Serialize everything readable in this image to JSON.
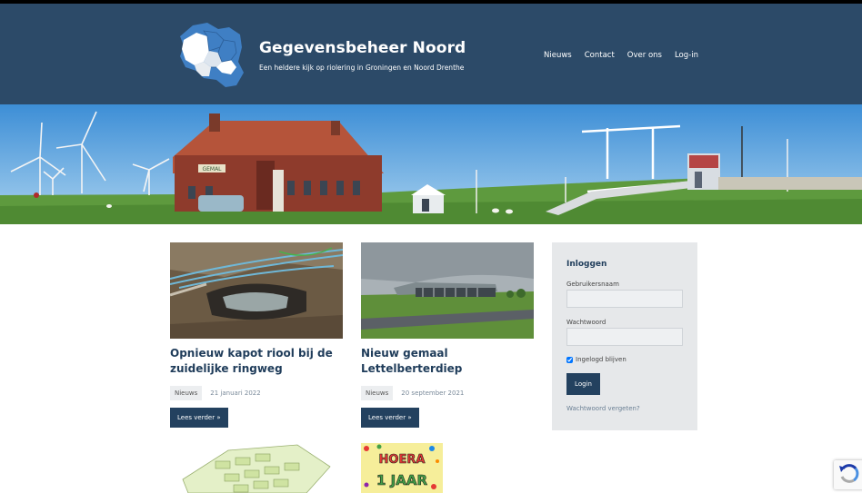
{
  "header": {
    "title": "Gegevensbeheer Noord",
    "tagline": "Een heldere kijk op riolering in Groningen en Noord Drenthe",
    "nav": [
      "Nieuws",
      "Contact",
      "Over ons",
      "Log-in"
    ]
  },
  "hero": {
    "building_sign": "GEMAL"
  },
  "posts": [
    {
      "title": "Opnieuw kapot riool bij de zuidelijke ringweg",
      "category": "Nieuws",
      "date": "21 januari 2022",
      "more": "Lees verder »"
    },
    {
      "title": "Nieuw gemaal Lettelberterdiep",
      "category": "Nieuws",
      "date": "20 september 2021",
      "more": "Lees verder »"
    },
    {
      "image_text_1": "HOERA",
      "image_text_2": "1 JAAR"
    }
  ],
  "login": {
    "heading": "Inloggen",
    "username_label": "Gebruikersnaam",
    "password_label": "Wachtwoord",
    "remember_label": "Ingelogd blijven",
    "remember_checked": true,
    "submit_label": "Login",
    "forgot_label": "Wachtwoord vergeten?"
  },
  "colors": {
    "header_bg": "#2c4a68",
    "accent": "#23415f",
    "title_color": "#1f3c5a"
  }
}
